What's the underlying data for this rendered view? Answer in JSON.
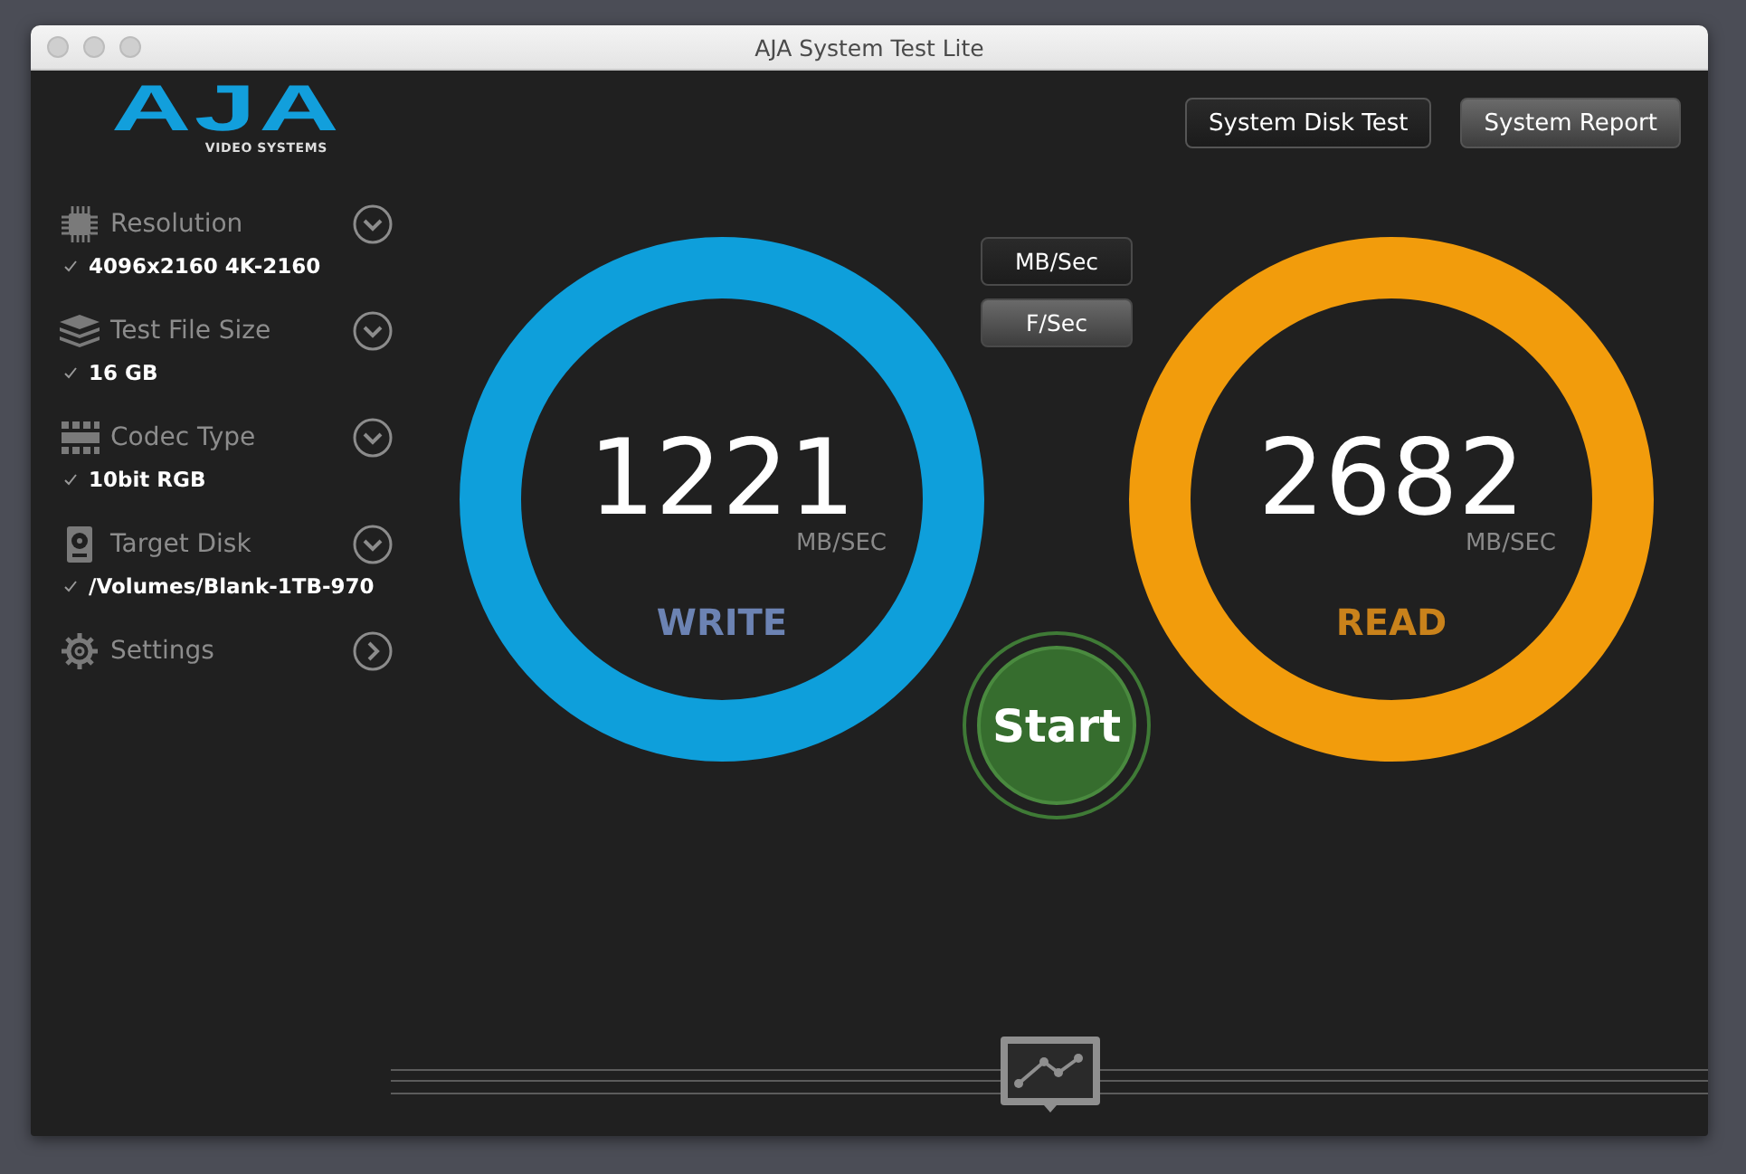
{
  "window": {
    "title": "AJA System Test Lite"
  },
  "logo": {
    "mark": "AJA",
    "tagline": "VIDEO SYSTEMS"
  },
  "header_buttons": [
    "System Disk Test",
    "System Report"
  ],
  "sidebar": {
    "items": [
      {
        "kind": "dropdown",
        "label": "Resolution",
        "value": "4096x2160 4K-2160",
        "checked": true
      },
      {
        "kind": "dropdown",
        "label": "Test File Size",
        "value": "16 GB",
        "checked": true
      },
      {
        "kind": "dropdown",
        "label": "Codec Type",
        "value": "10bit RGB",
        "checked": true
      },
      {
        "kind": "dropdown",
        "label": "Target Disk",
        "value": "/Volumes/Blank-1TB-970",
        "checked": true
      },
      {
        "kind": "link",
        "label": "Settings"
      }
    ]
  },
  "units": [
    {
      "label": "MB/Sec",
      "selected": true
    },
    {
      "label": "F/Sec",
      "selected": false
    }
  ],
  "gauges": [
    {
      "kind": "write",
      "value": "1221",
      "unit": "MB/SEC",
      "label": "WRITE",
      "color": "#0e9fdb"
    },
    {
      "kind": "read",
      "value": "2682",
      "unit": "MB/SEC",
      "label": "READ",
      "color": "#f29c0c"
    }
  ],
  "start_button": {
    "label": "Start"
  }
}
